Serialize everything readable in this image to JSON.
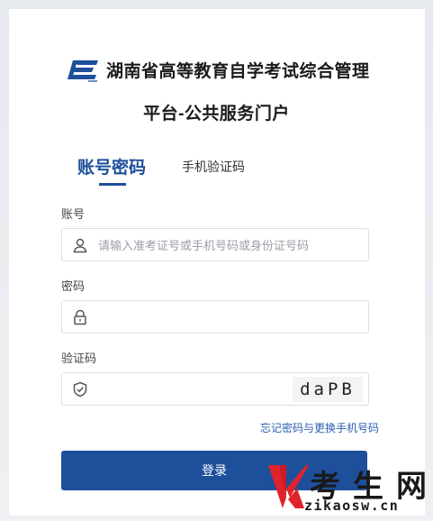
{
  "header": {
    "title_line1": "湖南省高等教育自学考试综合管理",
    "title_line2": "平台-公共服务门户",
    "logo_icon": "exam-authority-logo"
  },
  "tabs": [
    {
      "label": "账号密码",
      "active": true
    },
    {
      "label": "手机验证码",
      "active": false
    }
  ],
  "form": {
    "account": {
      "label": "账号",
      "placeholder": "请输入准考证号或手机号码或身份证号码",
      "value": "",
      "icon": "user-icon"
    },
    "password": {
      "label": "密码",
      "placeholder": "",
      "value": "",
      "icon": "lock-icon"
    },
    "captcha": {
      "label": "验证码",
      "placeholder": "",
      "value": "",
      "icon": "shield-check-icon",
      "image_text": "daPB"
    },
    "forgot_link": "忘记密码与更换手机号码",
    "login_button": "登录"
  },
  "watermark": {
    "brand": "考生网",
    "url": "zikaosw.cn"
  },
  "colors": {
    "primary": "#1d4f9a",
    "link": "#2a5fb0",
    "watermark_red": "#e0232b"
  }
}
